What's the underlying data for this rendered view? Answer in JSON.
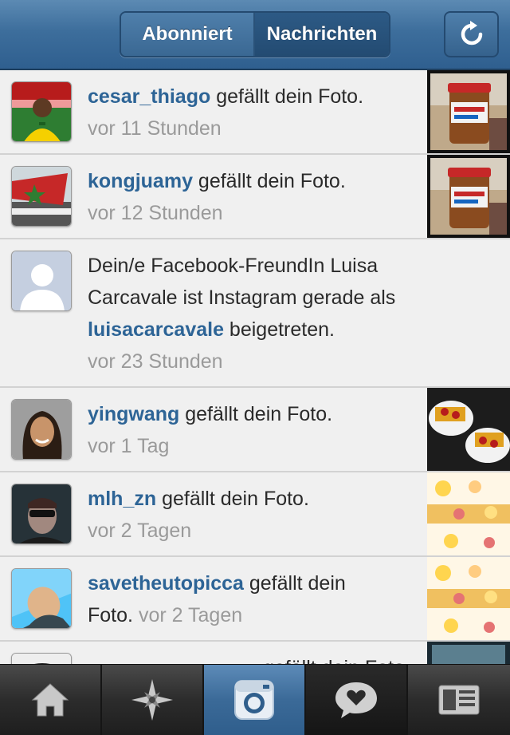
{
  "header": {
    "tabs": [
      {
        "label": "Abonniert",
        "selected": false
      },
      {
        "label": "Nachrichten",
        "selected": true
      }
    ],
    "refresh_icon": "refresh-icon"
  },
  "feed": {
    "items": [
      {
        "user": "cesar_thiago",
        "action": " gefällt dein Foto.",
        "time": "vor 11 Stunden"
      },
      {
        "user": "kongjuamy",
        "action": " gefällt dein Foto.",
        "time": "vor 12 Stunden"
      },
      {
        "line1": "Dein/e Facebook-FreundIn Luisa",
        "line2": "Carcavale ist Instagram gerade als",
        "user": "luisacarcavale",
        "action": " beigetreten.",
        "time": "vor 23 Stunden"
      },
      {
        "user": "yingwang",
        "action": " gefällt dein Foto.",
        "time": "vor 1 Tag"
      },
      {
        "user": "mlh_zn",
        "action": " gefällt dein Foto.",
        "time": "vor 2 Tagen"
      },
      {
        "user": "savetheutopicca",
        "action": " gefällt dein",
        "action2": "Foto.",
        "time": "vor 2 Tagen"
      }
    ],
    "partial_item": {
      "user": "",
      "action": "gefällt dein Foto."
    }
  },
  "tabbar": {
    "items": [
      {
        "icon": "home-icon"
      },
      {
        "icon": "explore-star-icon"
      },
      {
        "icon": "camera-icon"
      },
      {
        "icon": "news-heart-bubble-icon"
      },
      {
        "icon": "profile-card-icon"
      }
    ],
    "active_index": 2,
    "colors": {
      "active": "#3b6a98",
      "link": "#2d6496"
    }
  }
}
